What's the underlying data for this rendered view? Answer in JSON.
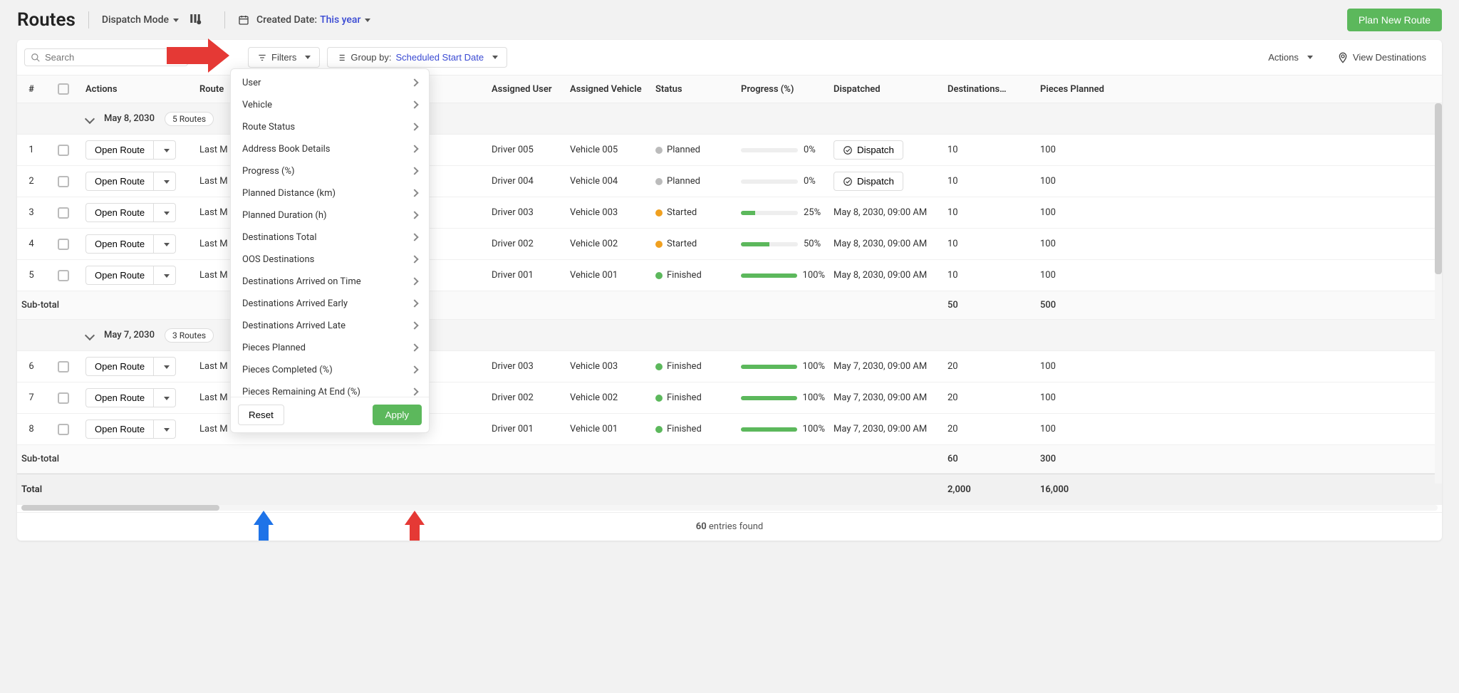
{
  "header": {
    "title": "Routes",
    "dispatch_mode": "Dispatch Mode",
    "created_label": "Created Date:",
    "created_value": "This year",
    "plan_new": "Plan New Route"
  },
  "toolbar": {
    "search_placeholder": "Search",
    "filters": "Filters",
    "group_by_label": "Group by:",
    "group_by_value": "Scheduled Start Date",
    "actions": "Actions",
    "view_destinations": "View Destinations"
  },
  "columns": {
    "num": "#",
    "actions": "Actions",
    "route": "Route",
    "assigned_user": "Assigned User",
    "assigned_vehicle": "Assigned Vehicle",
    "status": "Status",
    "progress": "Progress (%)",
    "dispatched": "Dispatched",
    "destinations": "Destinations…",
    "pieces_planned": "Pieces Planned"
  },
  "open_route_label": "Open Route",
  "route_trunc": "Last M",
  "dispatch_label": "Dispatch",
  "subtotal_label": "Sub-total",
  "total_label": "Total",
  "groups": [
    {
      "date": "May 8, 2030",
      "count": "5 Routes",
      "rows": [
        {
          "n": "1",
          "user": "Driver 005",
          "vehicle": "Vehicle 005",
          "status": "Planned",
          "dot": "grey",
          "prog": 0,
          "prog_txt": "0%",
          "dispatched": "",
          "show_dispatch": true,
          "dest": "10",
          "pieces": "100"
        },
        {
          "n": "2",
          "user": "Driver 004",
          "vehicle": "Vehicle 004",
          "status": "Planned",
          "dot": "grey",
          "prog": 0,
          "prog_txt": "0%",
          "dispatched": "",
          "show_dispatch": true,
          "dest": "10",
          "pieces": "100"
        },
        {
          "n": "3",
          "user": "Driver 003",
          "vehicle": "Vehicle 003",
          "status": "Started",
          "dot": "orange",
          "prog": 25,
          "prog_txt": "25%",
          "dispatched": "May 8, 2030, 09:00 AM",
          "show_dispatch": false,
          "dest": "10",
          "pieces": "100"
        },
        {
          "n": "4",
          "user": "Driver 002",
          "vehicle": "Vehicle 002",
          "status": "Started",
          "dot": "orange",
          "prog": 50,
          "prog_txt": "50%",
          "dispatched": "May 8, 2030, 09:00 AM",
          "show_dispatch": false,
          "dest": "10",
          "pieces": "100"
        },
        {
          "n": "5",
          "user": "Driver 001",
          "vehicle": "Vehicle 001",
          "status": "Finished",
          "dot": "green",
          "prog": 100,
          "prog_txt": "100%",
          "dispatched": "May 8, 2030, 09:00 AM",
          "show_dispatch": false,
          "dest": "10",
          "pieces": "100"
        }
      ],
      "sub_dest": "50",
      "sub_pieces": "500"
    },
    {
      "date": "May 7, 2030",
      "count": "3 Routes",
      "rows": [
        {
          "n": "6",
          "user": "Driver 003",
          "vehicle": "Vehicle 003",
          "status": "Finished",
          "dot": "green",
          "prog": 100,
          "prog_txt": "100%",
          "dispatched": "May 7, 2030, 09:00 AM",
          "show_dispatch": false,
          "dest": "20",
          "pieces": "100"
        },
        {
          "n": "7",
          "user": "Driver 002",
          "vehicle": "Vehicle 002",
          "status": "Finished",
          "dot": "green",
          "prog": 100,
          "prog_txt": "100%",
          "dispatched": "May 7, 2030, 09:00 AM",
          "show_dispatch": false,
          "dest": "20",
          "pieces": "100"
        },
        {
          "n": "8",
          "user": "Driver 001",
          "vehicle": "Vehicle 001",
          "status": "Finished",
          "dot": "green",
          "prog": 100,
          "prog_txt": "100%",
          "dispatched": "May 7, 2030, 09:00 AM",
          "show_dispatch": false,
          "dest": "20",
          "pieces": "100"
        }
      ],
      "sub_dest": "60",
      "sub_pieces": "300"
    }
  ],
  "total": {
    "dest": "2,000",
    "pieces": "16,000"
  },
  "footer": {
    "count": "60",
    "text": " entries found"
  },
  "filter_items": [
    "User",
    "Vehicle",
    "Route Status",
    "Address Book Details",
    "Progress (%)",
    "Planned Distance (km)",
    "Planned Duration (h)",
    "Destinations Total",
    "OOS Destinations",
    "Destinations Arrived on Time",
    "Destinations Arrived Early",
    "Destinations Arrived Late",
    "Pieces Planned",
    "Pieces Completed (%)",
    "Pieces Remaining At End (%)"
  ],
  "filter_footer": {
    "reset": "Reset",
    "apply": "Apply"
  }
}
